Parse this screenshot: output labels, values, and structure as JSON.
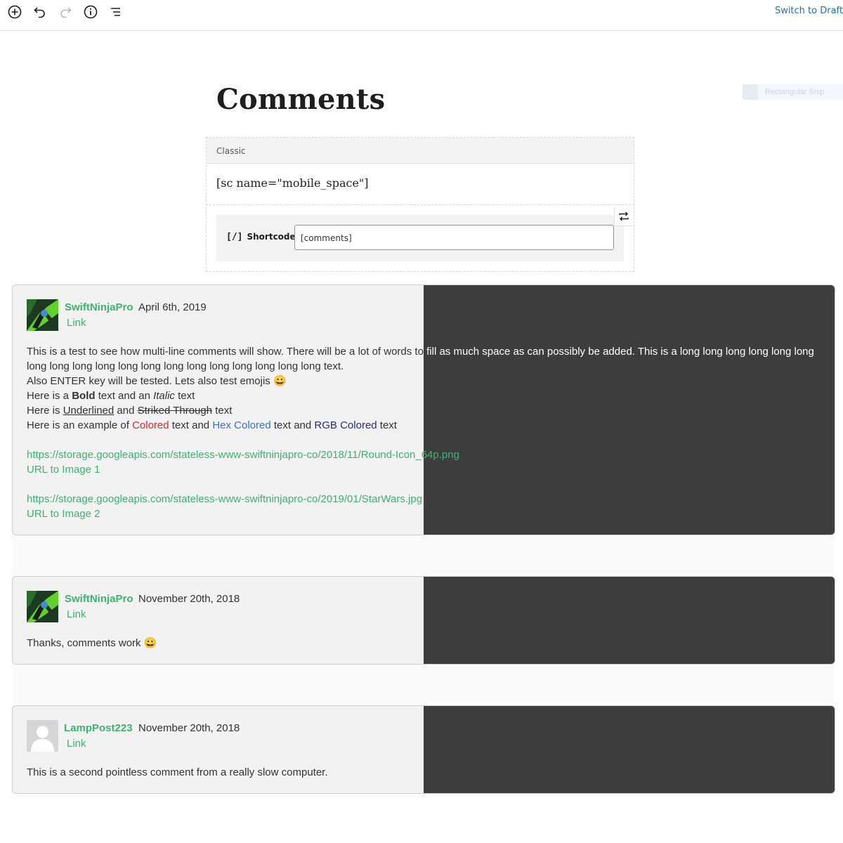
{
  "toolbar": {
    "icons": [
      "add-block-icon",
      "undo-icon",
      "redo-icon",
      "info-icon",
      "list-view-icon"
    ],
    "switch_to_draft": "Switch to Draft"
  },
  "ghost_overlay": {
    "label": "Rectangular Snip"
  },
  "page": {
    "title": "Comments"
  },
  "classic_block": {
    "header": "Classic",
    "content": "[sc name=\"mobile_space\"]"
  },
  "shortcode_block": {
    "icon_text": "[/]",
    "label": "Shortcode",
    "value": "[comments]"
  },
  "comments": [
    {
      "author": "SwiftNinjaPro",
      "date": "April 6th, 2019",
      "link": "Link",
      "line1_part_a": "This is a test to see how multi-line comments will show. There will be a lot of words to",
      "line1_part_b": " fill as much space as can possibly be added. This is a long long long long long long",
      "line2": "long long long long long long long long long long long long long text.",
      "line3": "Also ENTER key will be tested. Lets also test emojis 😀",
      "bold_pre": "Here is a ",
      "bold_word": "Bold",
      "bold_mid": " text and an ",
      "italic_word": "Italic",
      "bold_post": " text",
      "under_pre": "Here is ",
      "underlined": "Underlined",
      "under_mid": " and ",
      "striked": "Striked Through",
      "under_post": " text",
      "color_pre": "Here is an example of ",
      "colored": "Colored",
      "color_mid1": " text and ",
      "hex_colored": "Hex Colored",
      "color_mid2": " text and ",
      "rgb_colored": "RGB Colored",
      "color_post": " text",
      "url1_a": "https://storage.googleapis.com/stateless-www-swiftninjapro-co/2018/11/Round-Icon_",
      "url1_b": "64p.png",
      "url1_label": "URL to Image 1",
      "url2": "https://storage.googleapis.com/stateless-www-swiftninjapro-co/2019/01/StarWars.jpg",
      "url2_label": "URL to Image 2"
    },
    {
      "author": "SwiftNinjaPro",
      "date": "November 20th, 2018",
      "link": "Link",
      "text": "Thanks, comments work 😀"
    },
    {
      "author": "LampPost223",
      "date": "November 20th, 2018",
      "link": "Link",
      "text": "This is a second pointless comment from a really slow computer."
    }
  ],
  "colors": {
    "accent_green": "#3cb371",
    "colored_red": "#e3262e",
    "hex_blue": "#3a6fd8",
    "rgb_navy": "#2b2a86",
    "dark_panel": "#3d3d3d",
    "link_blue": "#2271b1"
  }
}
